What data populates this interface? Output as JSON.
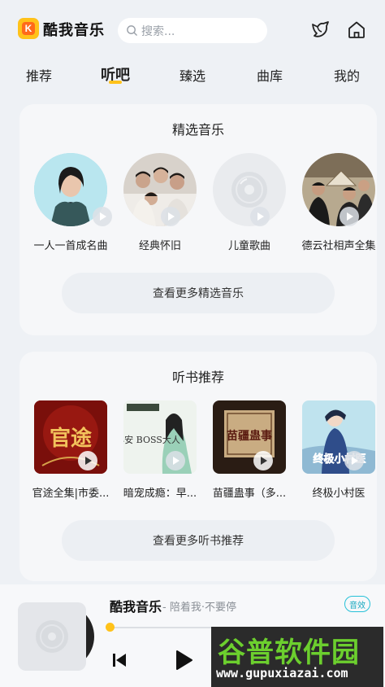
{
  "header": {
    "logo_letter": "K",
    "app_name": "酷我音乐",
    "search_placeholder": "搜索..."
  },
  "tabs": [
    {
      "label": "推荐",
      "active": false
    },
    {
      "label": "听吧",
      "active": true
    },
    {
      "label": "臻选",
      "active": false
    },
    {
      "label": "曲库",
      "active": false
    },
    {
      "label": "我的",
      "active": false
    }
  ],
  "featured_music": {
    "title": "精选音乐",
    "items": [
      {
        "label": "一人一首成名曲"
      },
      {
        "label": "经典怀旧"
      },
      {
        "label": "儿童歌曲"
      },
      {
        "label": "德云社相声全集"
      }
    ],
    "more_label": "查看更多精选音乐"
  },
  "audiobooks": {
    "title": "听书推荐",
    "items": [
      {
        "label": "官途全集|市委...",
        "cover_text": "官途"
      },
      {
        "label": "暗宠成瘾：早...",
        "cover_text": "早安 BOSS大人"
      },
      {
        "label": "苗疆蛊事（多...",
        "cover_text": "苗疆蛊事"
      },
      {
        "label": "终极小村医",
        "cover_text": "终极小村医"
      }
    ],
    "more_label": "查看更多听书推荐"
  },
  "player": {
    "title": "酷我音乐",
    "subtitle": "- 陪着我·不要停",
    "badge": "音效",
    "progress": 0.0
  },
  "watermark": {
    "logo": "谷普软件园",
    "url": "www.gupuxiazai.com"
  },
  "colors": {
    "accent": "#ffc21a",
    "background": "#eef1f5",
    "card": "#f6f7f9",
    "badge": "#1aa9c0"
  }
}
